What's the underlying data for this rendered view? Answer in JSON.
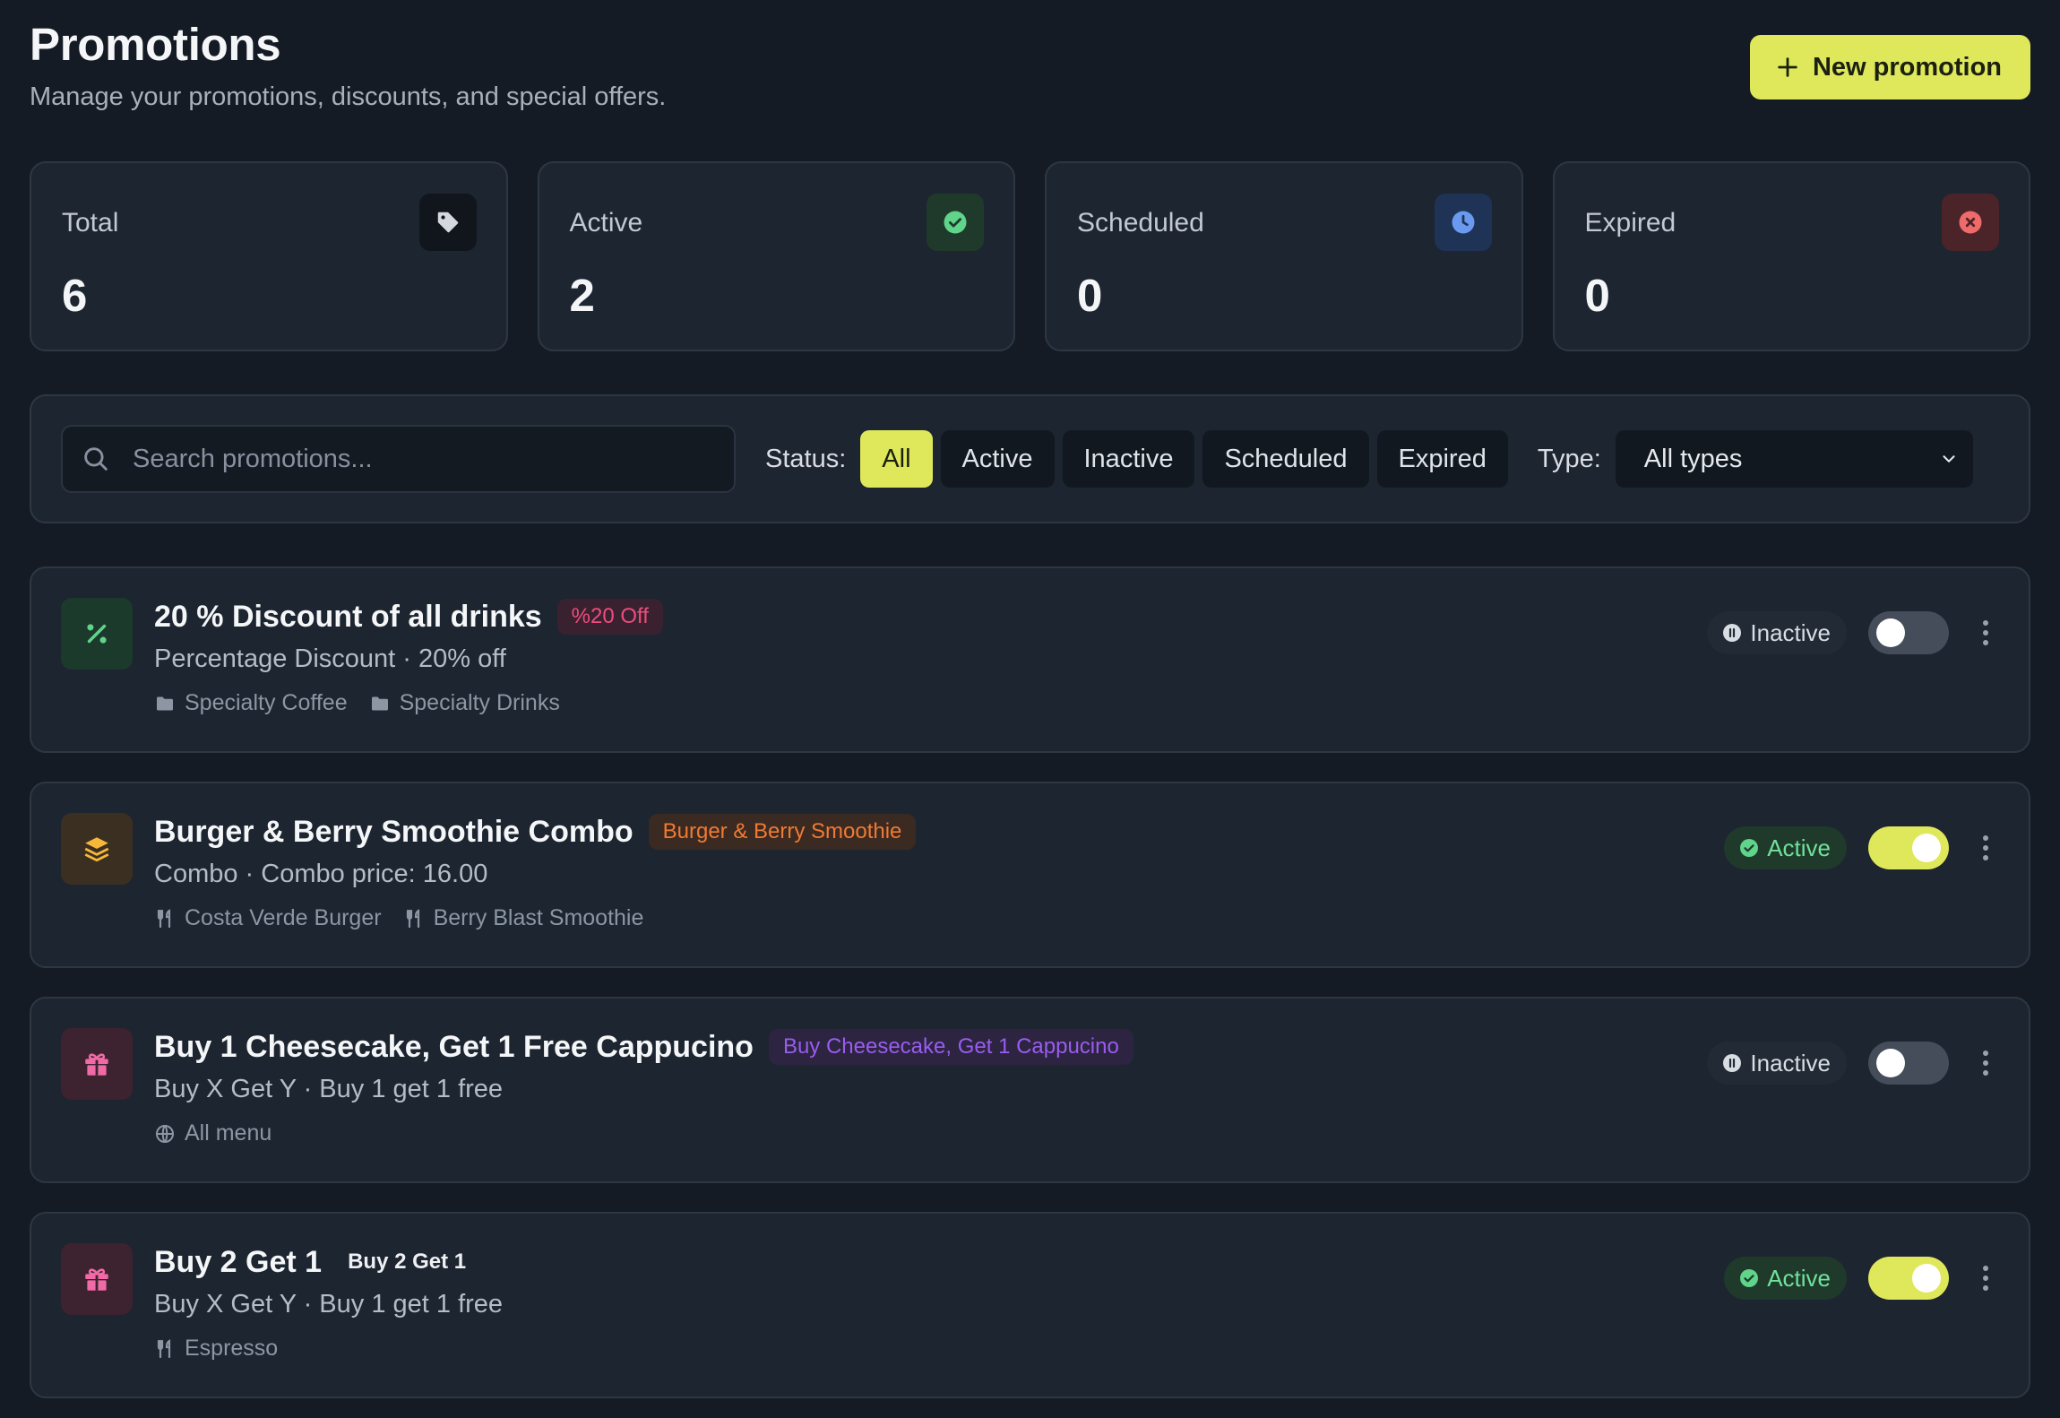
{
  "header": {
    "title": "Promotions",
    "subtitle": "Manage your promotions, discounts, and special offers.",
    "new_button_label": "New promotion"
  },
  "stats": [
    {
      "label": "Total",
      "value": "6",
      "icon": "tag-icon"
    },
    {
      "label": "Active",
      "value": "2",
      "icon": "check-circle-icon"
    },
    {
      "label": "Scheduled",
      "value": "0",
      "icon": "clock-icon"
    },
    {
      "label": "Expired",
      "value": "0",
      "icon": "x-circle-icon"
    }
  ],
  "filters": {
    "search_placeholder": "Search promotions...",
    "search_value": "",
    "status_label": "Status:",
    "status_options": [
      "All",
      "Active",
      "Inactive",
      "Scheduled",
      "Expired"
    ],
    "status_selected": "All",
    "type_label": "Type:",
    "type_selected": "All types"
  },
  "promotions": [
    {
      "title": "20 % Discount of all drinks",
      "badge": "%20 Off",
      "subtitle": "Percentage Discount · 20% off",
      "icon": "percent-icon",
      "tags": [
        "Specialty Coffee",
        "Specialty Drinks"
      ],
      "tag_icon": "folder-icon",
      "status": "Inactive",
      "enabled": false
    },
    {
      "title": "Burger & Berry Smoothie Combo",
      "badge": "Burger & Berry Smoothie",
      "subtitle": "Combo · Combo price: 16.00",
      "icon": "layers-icon",
      "tags": [
        "Costa Verde Burger",
        "Berry Blast Smoothie"
      ],
      "tag_icon": "utensils-icon",
      "status": "Active",
      "enabled": true
    },
    {
      "title": "Buy 1 Cheesecake, Get 1 Free Cappucino",
      "badge": "Buy Cheesecake, Get 1 Cappucino",
      "subtitle": "Buy X Get Y · Buy 1 get 1 free",
      "icon": "gift-icon",
      "tags": [
        "All menu"
      ],
      "tag_icon": "globe-icon",
      "status": "Inactive",
      "enabled": false
    },
    {
      "title": "Buy 2 Get 1",
      "badge": "Buy 2 Get 1",
      "subtitle": "Buy X Get Y · Buy 1 get 1 free",
      "icon": "gift-icon",
      "tags": [
        "Espresso"
      ],
      "tag_icon": "utensils-icon",
      "status": "Active",
      "enabled": true
    }
  ],
  "colors": {
    "accent": "#dfe85a",
    "background": "#151b24",
    "card": "#1d2530",
    "active_green": "#6fe29a",
    "badge_pink": "#ec4d7d",
    "badge_orange": "#f07a32",
    "badge_purple": "#9a5cf0"
  }
}
